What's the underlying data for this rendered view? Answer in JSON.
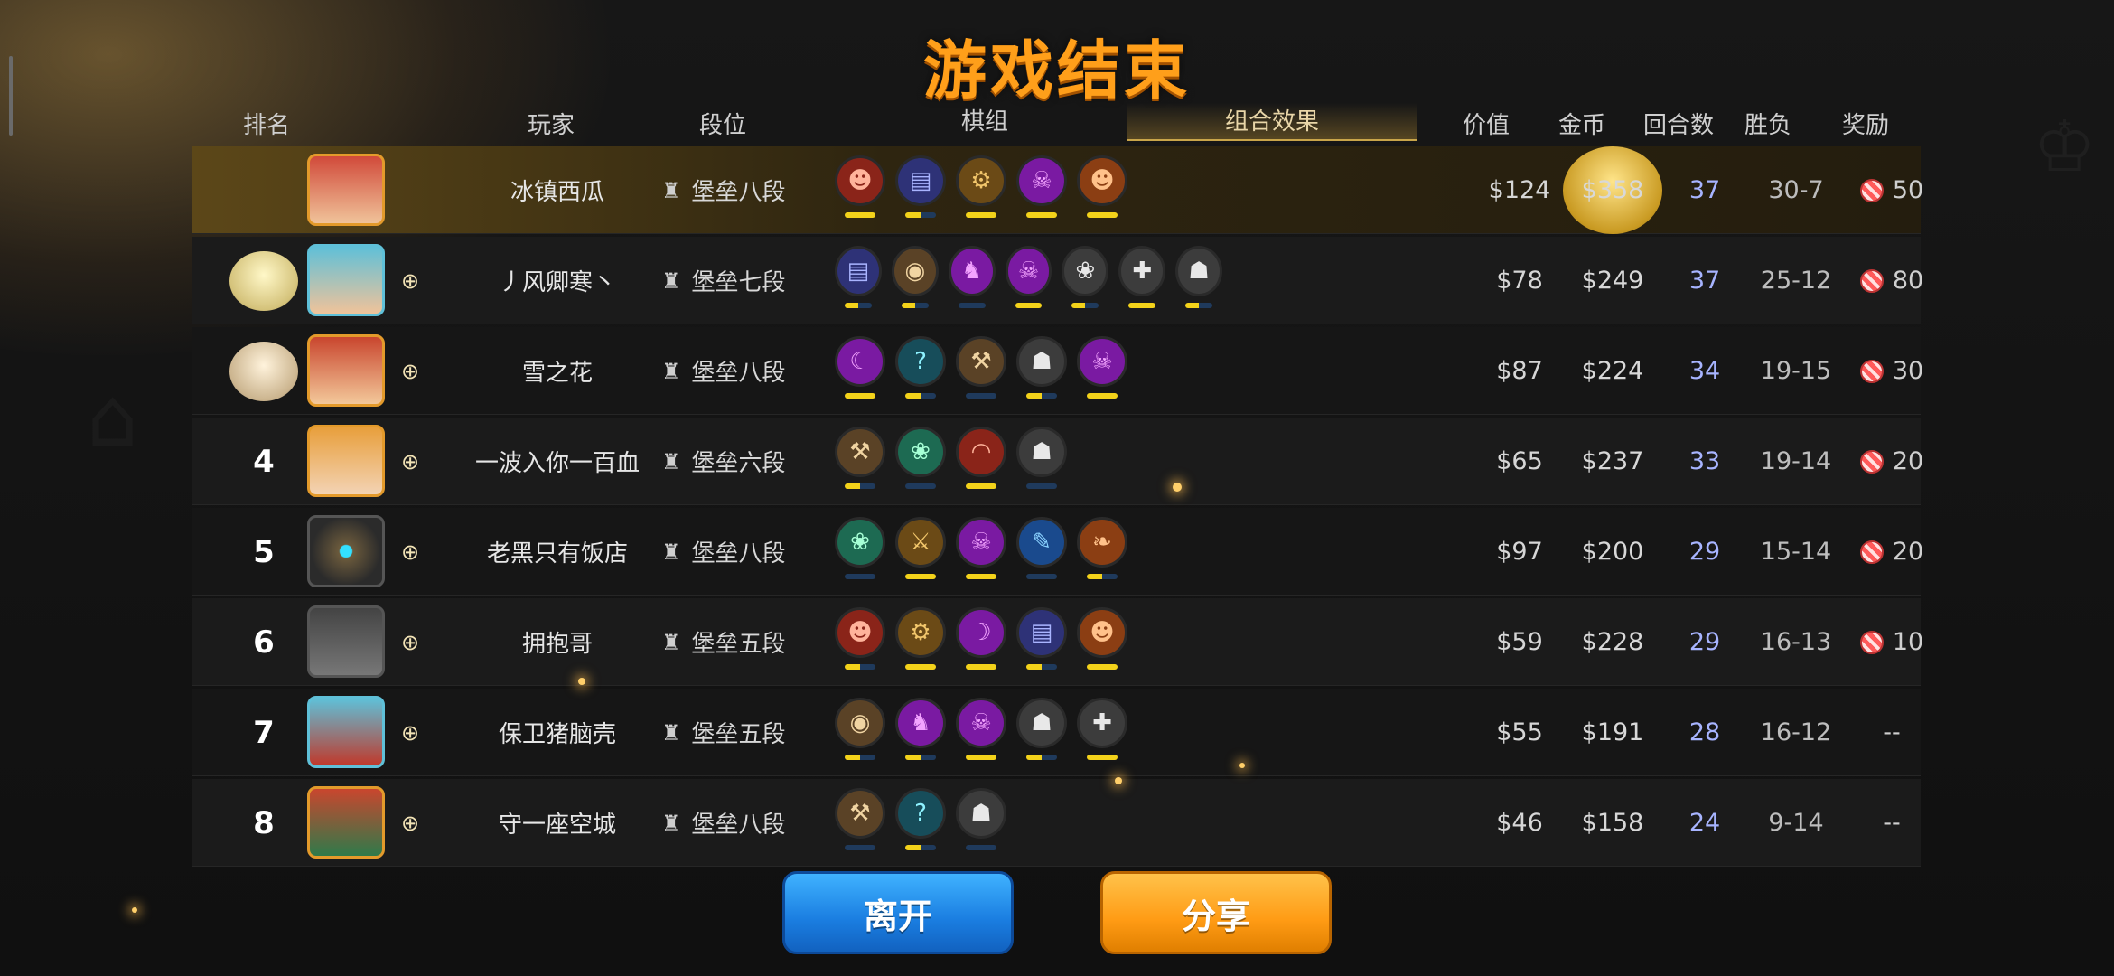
{
  "title": "游戏结束",
  "headers": {
    "rank": "排名",
    "player": "玩家",
    "tier": "段位",
    "team": "棋组",
    "synergy": "组合效果",
    "value": "价值",
    "gold": "金币",
    "rounds": "回合数",
    "winloss": "胜负",
    "reward": "奖励"
  },
  "rows": [
    {
      "rank": "",
      "medal": "gold",
      "name": "冰镇西瓜",
      "tier": "堡垒八段",
      "value": "$124",
      "gold": "$358",
      "rounds": "37",
      "winloss": "30-7",
      "reward": "50",
      "has_reward_icon": true
    },
    {
      "rank": "",
      "medal": "silver",
      "name": "丿风卿寒丶",
      "tier": "堡垒七段",
      "value": "$78",
      "gold": "$249",
      "rounds": "37",
      "winloss": "25-12",
      "reward": "80",
      "has_reward_icon": true
    },
    {
      "rank": "",
      "medal": "bronze",
      "name": "雪之花",
      "tier": "堡垒八段",
      "value": "$87",
      "gold": "$224",
      "rounds": "34",
      "winloss": "19-15",
      "reward": "30",
      "has_reward_icon": true
    },
    {
      "rank": "4",
      "name": "一波入你一百血",
      "tier": "堡垒六段",
      "value": "$65",
      "gold": "$237",
      "rounds": "33",
      "winloss": "19-14",
      "reward": "20",
      "has_reward_icon": true
    },
    {
      "rank": "5",
      "name": "老黑只有饭店",
      "tier": "堡垒八段",
      "value": "$97",
      "gold": "$200",
      "rounds": "29",
      "winloss": "15-14",
      "reward": "20",
      "has_reward_icon": true
    },
    {
      "rank": "6",
      "name": "拥抱哥",
      "tier": "堡垒五段",
      "value": "$59",
      "gold": "$228",
      "rounds": "29",
      "winloss": "16-13",
      "reward": "10",
      "has_reward_icon": true
    },
    {
      "rank": "7",
      "name": "保卫猪脑壳",
      "tier": "堡垒五段",
      "value": "$55",
      "gold": "$191",
      "rounds": "28",
      "winloss": "16-12",
      "reward": "--",
      "has_reward_icon": false
    },
    {
      "rank": "8",
      "name": "守一座空城",
      "tier": "堡垒八段",
      "value": "$46",
      "gold": "$158",
      "rounds": "24",
      "winloss": "9-14",
      "reward": "--",
      "has_reward_icon": false
    }
  ],
  "buttons": {
    "leave": "离开",
    "share": "分享"
  },
  "colors": {
    "title": "#ff9f1a",
    "leave": "#1a7de0",
    "share": "#ff9b14",
    "rounds": "#a7b4ff"
  }
}
